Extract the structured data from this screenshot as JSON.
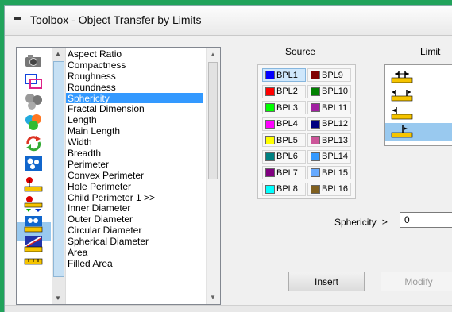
{
  "window": {
    "title": "Toolbox - Object Transfer by Limits"
  },
  "features": {
    "items": [
      "Aspect Ratio",
      "Compactness",
      "Roughness",
      "Roundness",
      "Sphericity",
      "Fractal Dimension",
      "Length",
      "Main Length",
      "Width",
      "Breadth",
      "Perimeter",
      "Convex Perimeter",
      "Hole Perimeter",
      "Child Perimeter 1 >>",
      "Inner Diameter",
      "Outer Diameter",
      "Circular Diameter",
      "Spherical Diameter",
      "Area",
      "Filled Area"
    ],
    "selected": "Sphericity"
  },
  "tool_icons": [
    "camera-icon",
    "copy-frames-icon",
    "grey-spheres-icon",
    "color-spheres-icon",
    "refresh-arrows-icon",
    "connected-nodes-icon",
    "ruler-pin-icon",
    "ruler-pin-arrows-icon",
    "node-ruler-icon",
    "diagonal-line-icon"
  ],
  "source": {
    "label": "Source",
    "left": [
      {
        "name": "BPL1",
        "color": "#0000ff",
        "selected": true
      },
      {
        "name": "BPL2",
        "color": "#ff0000",
        "selected": false
      },
      {
        "name": "BPL3",
        "color": "#00ff00",
        "selected": false
      },
      {
        "name": "BPL4",
        "color": "#ff00ff",
        "selected": false
      },
      {
        "name": "BPL5",
        "color": "#ffff00",
        "selected": false
      },
      {
        "name": "BPL6",
        "color": "#008080",
        "selected": false
      },
      {
        "name": "BPL7",
        "color": "#800080",
        "selected": false
      },
      {
        "name": "BPL8",
        "color": "#00ffff",
        "selected": false
      }
    ],
    "right": [
      {
        "name": "BPL9",
        "color": "#800000"
      },
      {
        "name": "BPL10",
        "color": "#008000"
      },
      {
        "name": "BPL11",
        "color": "#a020a0"
      },
      {
        "name": "BPL12",
        "color": "#000080"
      },
      {
        "name": "BPL13",
        "color": "#cc5599"
      },
      {
        "name": "BPL14",
        "color": "#3399ff"
      },
      {
        "name": "BPL15",
        "color": "#66aaff"
      },
      {
        "name": "BPL16",
        "color": "#806020"
      }
    ]
  },
  "limit": {
    "label": "Limit",
    "options": [
      "range-between-limit-icon",
      "outside-range-limit-icon",
      "below-limit-icon",
      "above-limit-icon"
    ],
    "selected_index": 3
  },
  "condition": {
    "feature": "Sphericity",
    "operator": "≥",
    "value": "0"
  },
  "buttons": {
    "insert": "Insert",
    "modify": "Modify"
  }
}
